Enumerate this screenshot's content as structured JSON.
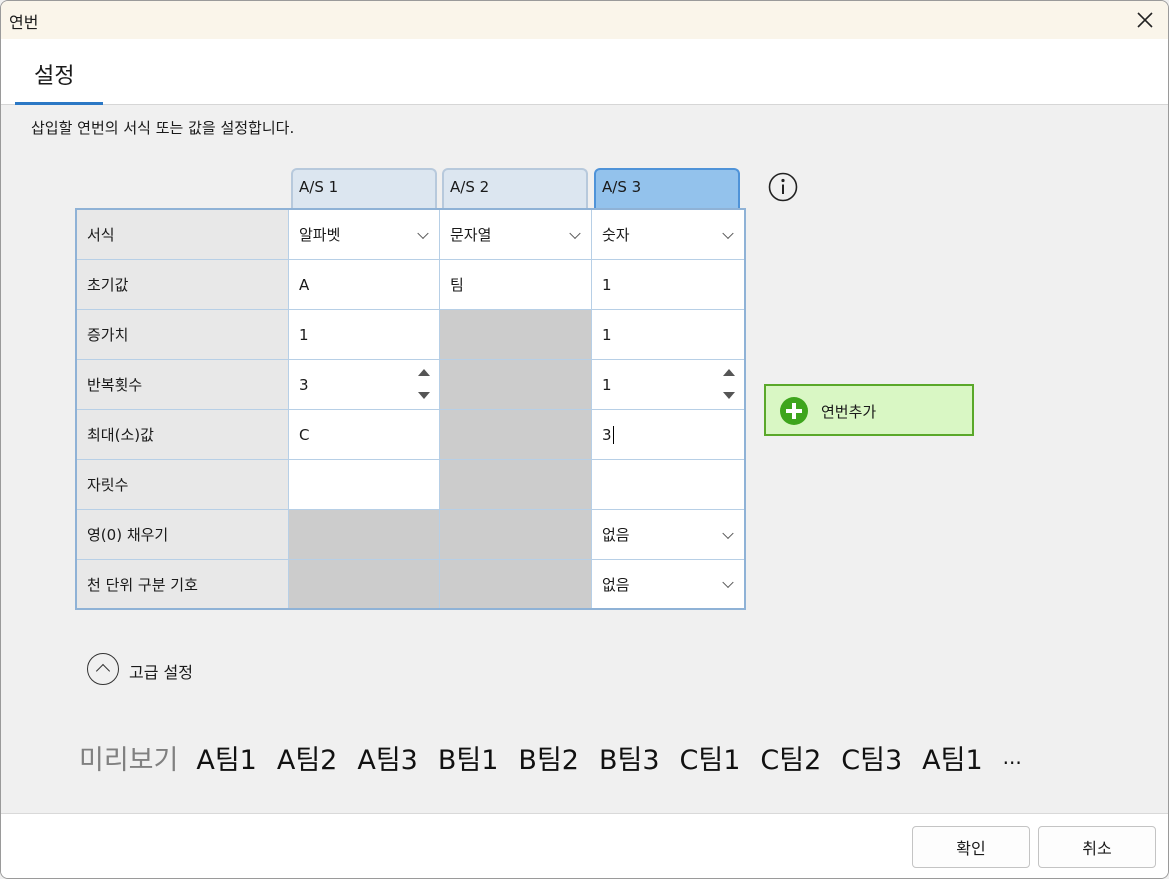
{
  "window": {
    "title": "연번"
  },
  "tabs": [
    {
      "label": "설정"
    }
  ],
  "description": "삽입할 연번의 서식 또는 값을 설정합니다.",
  "columns": [
    {
      "label": "A/S 1",
      "active": false
    },
    {
      "label": "A/S 2",
      "active": false
    },
    {
      "label": "A/S 3",
      "active": true
    }
  ],
  "rows": {
    "format": {
      "label": "서식",
      "values": [
        "알파벳",
        "문자열",
        "숫자"
      ]
    },
    "initial": {
      "label": "초기값",
      "values": [
        "A",
        "팀",
        "1"
      ]
    },
    "increment": {
      "label": "증가치",
      "values": [
        "1",
        "",
        "1"
      ]
    },
    "repeat": {
      "label": "반복횟수",
      "values": [
        "3",
        "",
        "1"
      ]
    },
    "max": {
      "label": "최대(소)값",
      "values": [
        "C",
        "",
        "3"
      ]
    },
    "digits": {
      "label": "자릿수",
      "values": [
        "",
        "",
        ""
      ]
    },
    "zerofill": {
      "label": "영(0) 채우기",
      "values": [
        "",
        "",
        "없음"
      ]
    },
    "thousands": {
      "label": "천 단위 구분 기호",
      "values": [
        "",
        "",
        "없음"
      ]
    }
  },
  "add_button": {
    "label": "연번추가"
  },
  "advanced": {
    "label": "고급 설정"
  },
  "preview": {
    "label": "미리보기",
    "items": [
      "A팀1",
      "A팀2",
      "A팀3",
      "B팀1",
      "B팀2",
      "B팀3",
      "C팀1",
      "C팀2",
      "C팀3",
      "A팀1",
      "..."
    ]
  },
  "footer": {
    "ok": "확인",
    "cancel": "취소"
  },
  "icons": {
    "close": "close-icon",
    "info": "info-icon",
    "add": "plus-circle-icon",
    "collapse": "chevron-up-circle-icon"
  },
  "colors": {
    "accent": "#2b78c5",
    "active_tab": "#93c2ec",
    "add_fill": "#d9f7c4",
    "add_border": "#5aa82a"
  }
}
